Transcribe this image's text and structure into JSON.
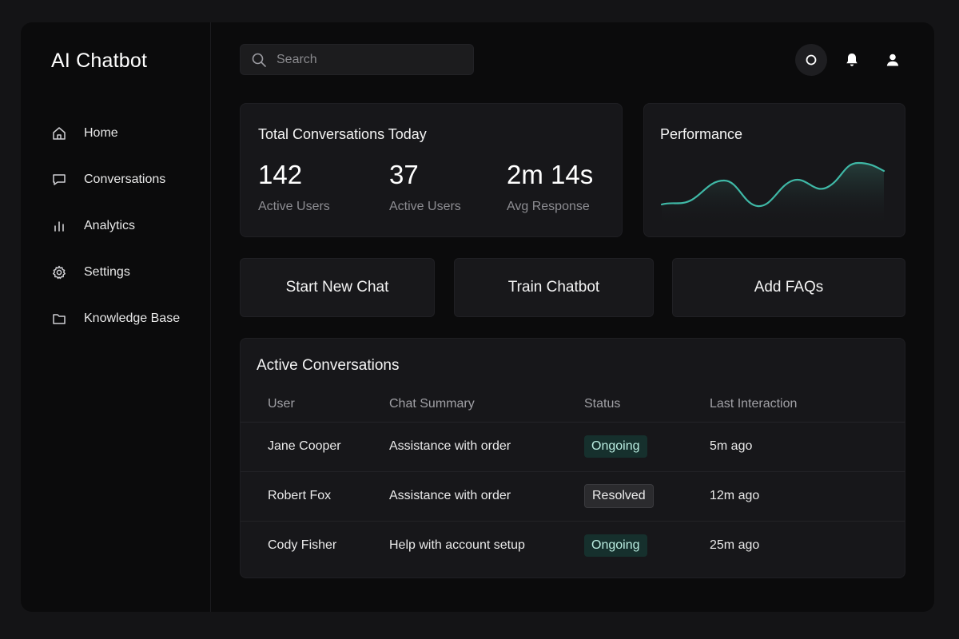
{
  "app": {
    "title": "AI Chatbot"
  },
  "sidebar": {
    "items": [
      {
        "label": "Home",
        "icon": "home-icon"
      },
      {
        "label": "Conversations",
        "icon": "chat-bubble-icon"
      },
      {
        "label": "Analytics",
        "icon": "bar-chart-icon"
      },
      {
        "label": "Settings",
        "icon": "gear-icon"
      },
      {
        "label": "Knowledge Base",
        "icon": "folder-icon"
      }
    ]
  },
  "header": {
    "search_placeholder": "Search",
    "icons": [
      "theme-toggle-icon",
      "bell-icon",
      "user-icon"
    ]
  },
  "stats": {
    "title": "Total Conversations Today",
    "items": [
      {
        "value": "142",
        "label": "Active Users"
      },
      {
        "value": "37",
        "label": "Active Users"
      },
      {
        "value": "2m 14s",
        "label": "Avg Response"
      }
    ]
  },
  "performance": {
    "title": "Performance",
    "accent": "#3fb8a6"
  },
  "actions": {
    "start_new_chat": "Start New Chat",
    "train_chatbot": "Train Chatbot",
    "add_faqs": "Add FAQs"
  },
  "conversations": {
    "title": "Active Conversations",
    "columns": [
      "User",
      "Chat Summary",
      "Status",
      "Last Interaction"
    ],
    "rows": [
      {
        "user": "Jane Cooper",
        "summary": "Assistance with order",
        "status": "Ongoing",
        "last": "5m ago"
      },
      {
        "user": "Robert Fox",
        "summary": "Assistance with order",
        "status": "Resolved",
        "last": "12m ago"
      },
      {
        "user": "Cody Fisher",
        "summary": "Help with account setup",
        "status": "Ongoing",
        "last": "25m ago"
      }
    ]
  },
  "colors": {
    "background": "#0b0b0c",
    "card": "#17171a",
    "ongoing_badge": "#16302d",
    "resolved_badge": "#2b2b2e"
  }
}
